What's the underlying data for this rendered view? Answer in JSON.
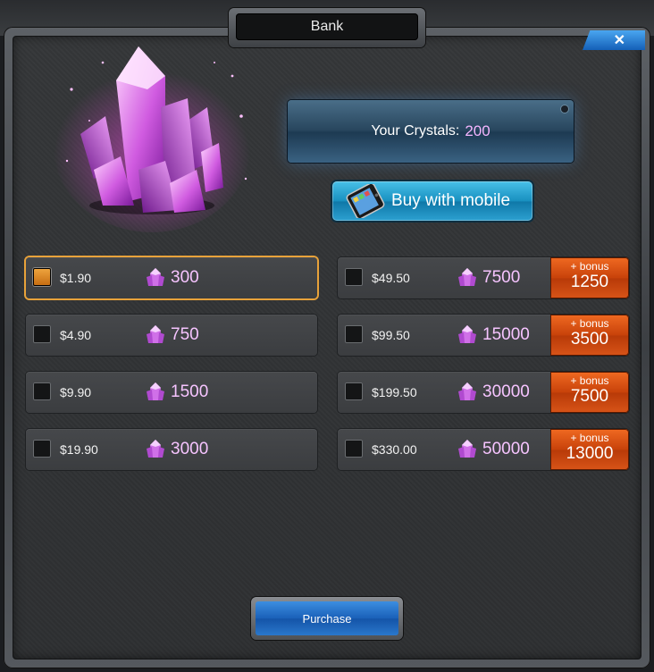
{
  "window": {
    "title": "Bank",
    "close_label": "✕"
  },
  "balance": {
    "label": "Your Crystals:",
    "value": "200"
  },
  "mobile_button": {
    "label": "Buy with mobile"
  },
  "packages_left": [
    {
      "price": "$1.90",
      "amount": "300",
      "selected": true
    },
    {
      "price": "$4.90",
      "amount": "750",
      "selected": false
    },
    {
      "price": "$9.90",
      "amount": "1500",
      "selected": false
    },
    {
      "price": "$19.90",
      "amount": "3000",
      "selected": false
    }
  ],
  "packages_right": [
    {
      "price": "$49.50",
      "amount": "7500",
      "bonus_label": "+ bonus",
      "bonus": "1250"
    },
    {
      "price": "$99.50",
      "amount": "15000",
      "bonus_label": "+ bonus",
      "bonus": "3500"
    },
    {
      "price": "$199.50",
      "amount": "30000",
      "bonus_label": "+ bonus",
      "bonus": "7500"
    },
    {
      "price": "$330.00",
      "amount": "50000",
      "bonus_label": "+ bonus",
      "bonus": "13000"
    }
  ],
  "purchase_button": {
    "label": "Purchase"
  },
  "icons": {
    "crystal": "crystal-icon",
    "phone": "phone-icon",
    "close": "close-icon"
  },
  "colors": {
    "accent_orange": "#e8a23a",
    "bonus_red": "#d0480e",
    "crystal_pink": "#f6c4ff",
    "button_blue": "#1a60b8"
  }
}
